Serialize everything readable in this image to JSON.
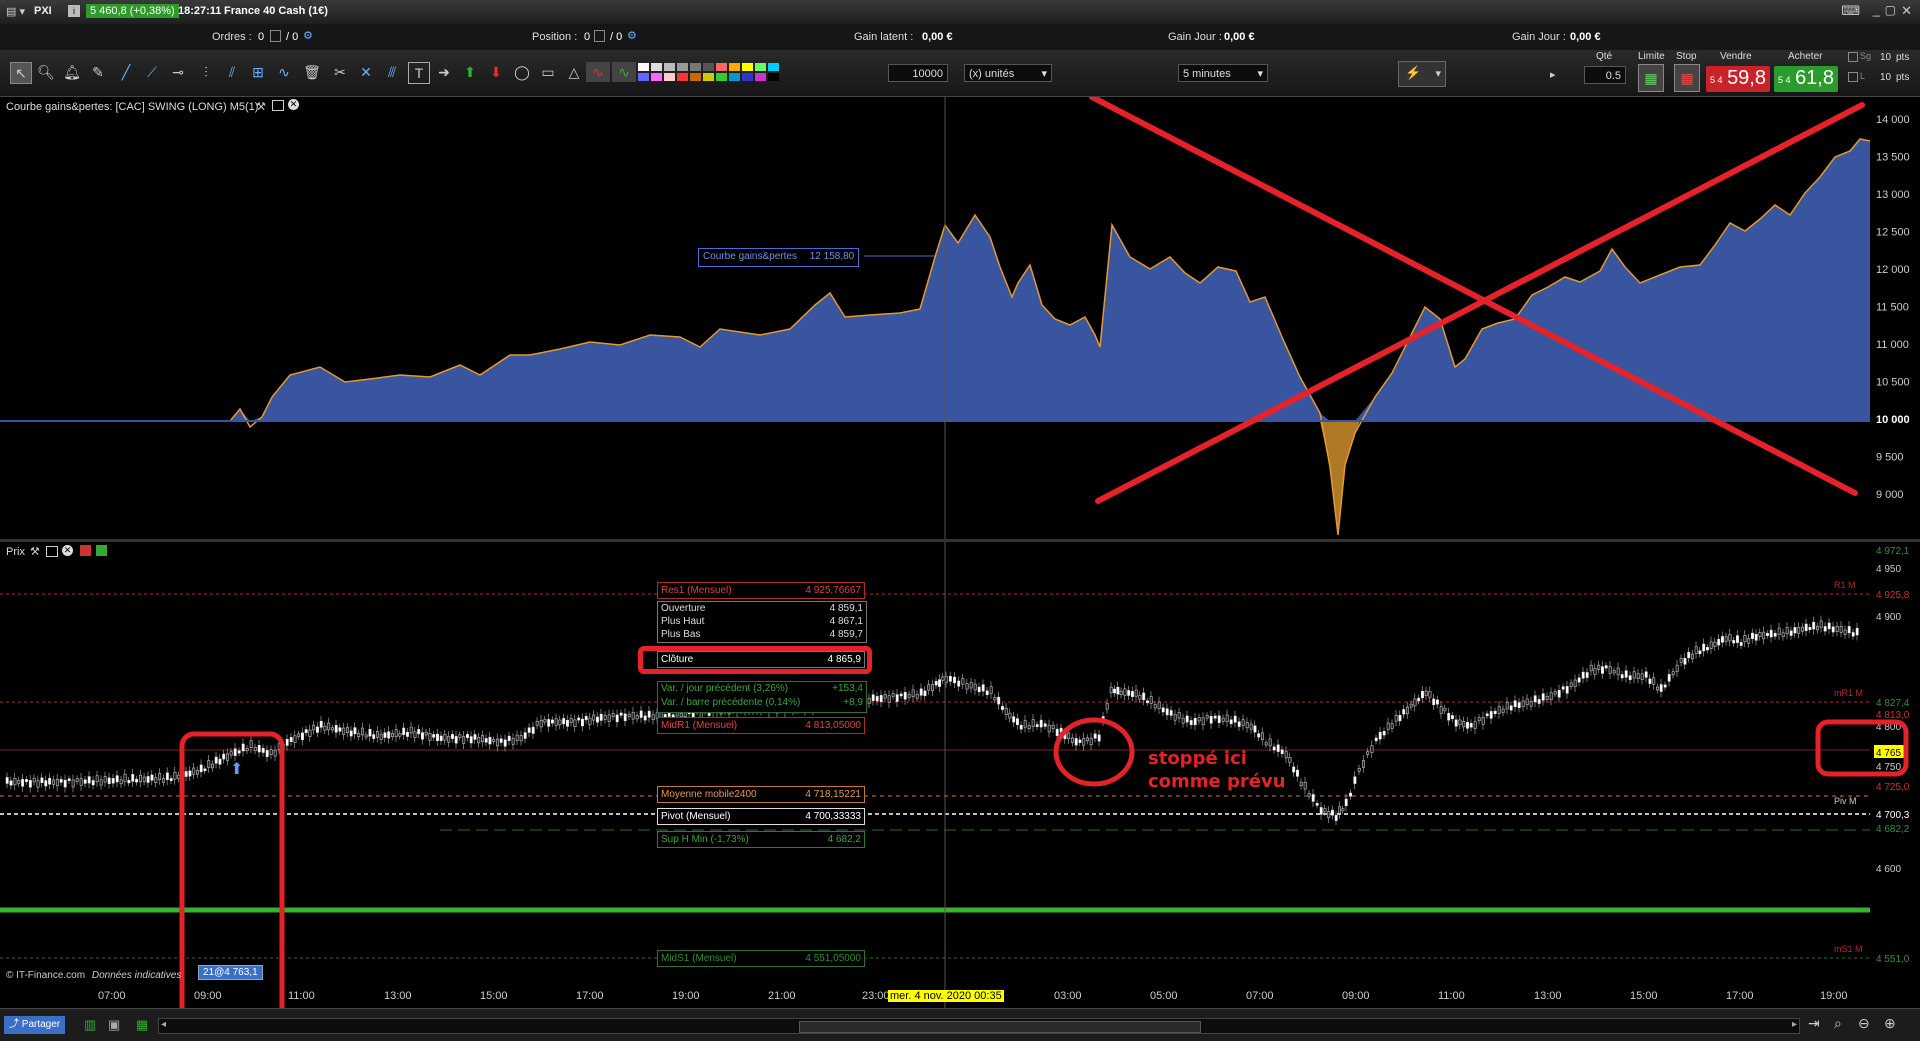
{
  "titlebar": {
    "app": "PXI",
    "index_change": "5 460,8 (+0,38%)",
    "clock": "18:27:11",
    "instrument": "France 40 Cash (1€)"
  },
  "infobar": {
    "orders_label": "Ordres :",
    "orders_value": "0",
    "orders_sep": "/ 0",
    "position_label": "Position :",
    "position_value": "0",
    "position_sep": "/ 0",
    "latent_label": "Gain latent :",
    "latent_value": "0,00 €",
    "day1_label": "Gain Jour :",
    "day1_value": "0,00 €",
    "day2_label": "Gain Jour :",
    "day2_value": "0,00 €"
  },
  "toolbar": {
    "quantity": "10000",
    "unit": "(x) unités",
    "timeframe": "5 minutes",
    "qty_header": "Qté",
    "qty_value": "0.5",
    "limit_header": "Limite",
    "stop_header": "Stop",
    "sell_header": "Vendre",
    "buy_header": "Acheter",
    "sell_prefix": "5 4",
    "sell_price": "59,8",
    "buy_prefix": "5 4",
    "buy_price": "61,8",
    "pts1": "10",
    "pts_unit": "pts",
    "pts2": "10",
    "sg": "Sg",
    "l": "L"
  },
  "upper_pane": {
    "title": "Courbe gains&pertes: [CAC] SWING (LONG) M5(1)",
    "tooltip_name": "Courbe gains&pertes",
    "tooltip_value": "12 158,80",
    "yticks": [
      "14 000",
      "13 500",
      "13 000",
      "12 500",
      "12 000",
      "11 500",
      "11 000",
      "10 500",
      "10 000",
      "9 500",
      "9 000"
    ]
  },
  "lower_pane": {
    "title": "Prix",
    "res1_name": "Res1 (Mensuel)",
    "res1_value": "4 925,76667",
    "ohlc": [
      {
        "k": "Ouverture",
        "v": "4 859,1"
      },
      {
        "k": "Plus Haut",
        "v": "4 867,1"
      },
      {
        "k": "Plus Bas",
        "v": "4 859,7"
      }
    ],
    "close_name": "Clôture",
    "close_value": "4 865,9",
    "var_day": "Var. / jour précédent (3,26%)",
    "var_day_v": "+153,4",
    "var_bar": "Var. / barre précédente (0,14%)",
    "var_bar_v": "+8,9",
    "midr1_name": "MidR1 (Mensuel)",
    "midr1_value": "4 813,05000",
    "ma_name": "Moyenne mobile2400",
    "ma_value": "4 718,15221",
    "pivot_name": "Pivot (Mensuel)",
    "pivot_value": "4 700,33333",
    "suph_name": "Sup H Min (-1,73%)",
    "suph_value": "4 682,2",
    "mids1_name": "MidS1 (Mensuel)",
    "mids1_value": "4 551,05000",
    "annotation_line1": "stoppé ici",
    "annotation_line2": "comme prévu",
    "source": "© IT-Finance.com",
    "source_note": "Données indicatives",
    "order_tag": "21@4 763,1",
    "yticks": [
      "4 972,1",
      "4 950",
      "4 925,8",
      "4 900",
      "4 827,4",
      "4 813,0",
      "4 800",
      "4 765",
      "4 750",
      "4 725,0",
      "4 700,3",
      "4 682,2",
      "4 600",
      "4 551,0"
    ],
    "right_tags": [
      "R1 M",
      "mR1 M",
      "Piv M",
      "mS1 M"
    ]
  },
  "time_axis": [
    "07:00",
    "09:00",
    "11:00",
    "13:00",
    "15:00",
    "17:00",
    "19:00",
    "21:00",
    "23:00",
    "mer. 4 nov. 2020 00:35",
    "03:00",
    "05:00",
    "07:00",
    "09:00",
    "11:00",
    "13:00",
    "15:00",
    "17:00",
    "19:00"
  ],
  "bottombar": {
    "share": "Partager"
  },
  "colors": {
    "fill": "#3a559f",
    "line": "#e39a2d",
    "neg": "#b07a25",
    "red": "#e5222a",
    "green": "#37b22f"
  }
}
